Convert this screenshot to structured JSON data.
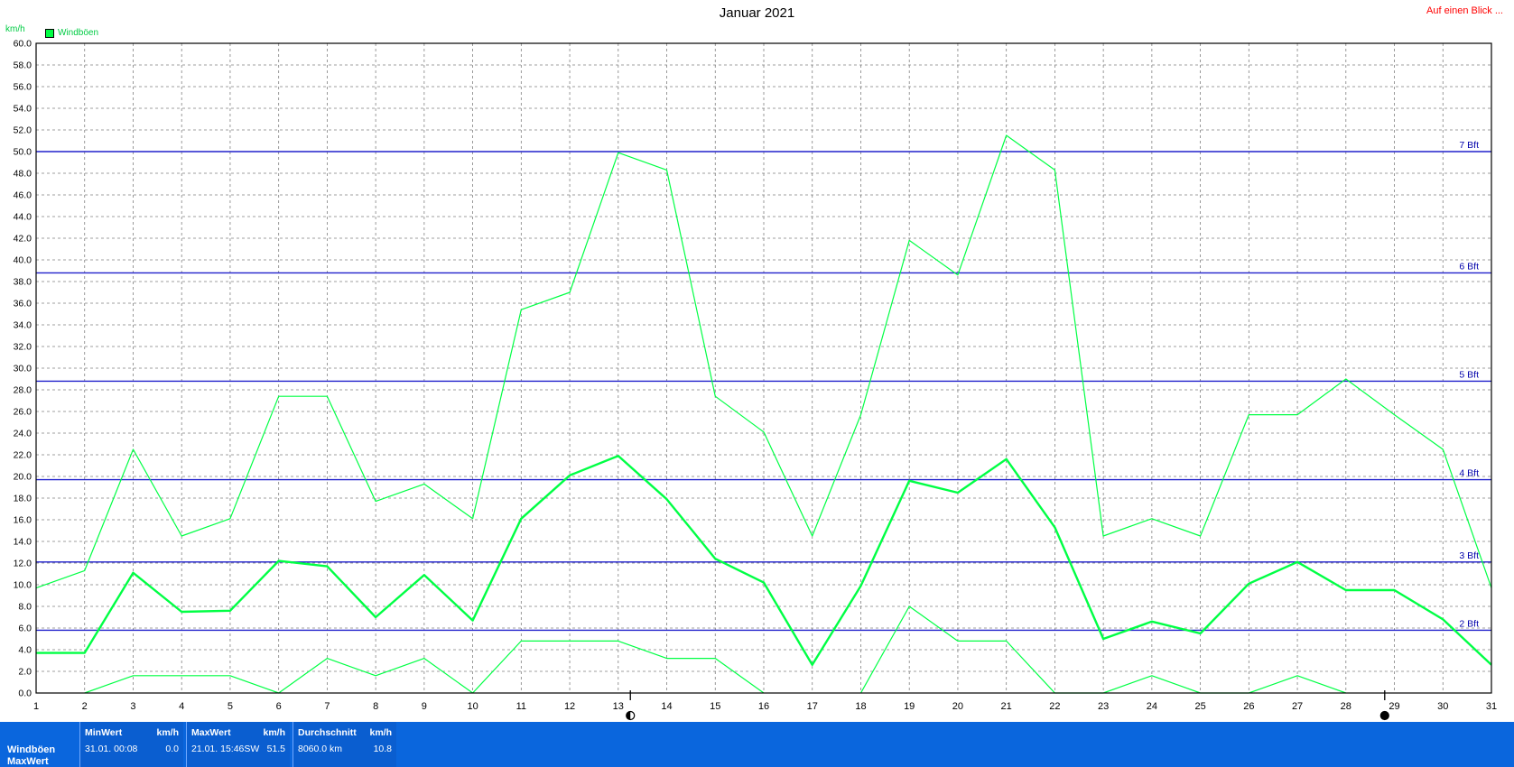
{
  "header": {
    "title": "Januar 2021",
    "link_label": "Auf einen Blick ...",
    "unit_label": "km/h"
  },
  "legend": {
    "label": "Windböen",
    "color": "#00ff44"
  },
  "chart_data": {
    "type": "line",
    "title": "Januar 2021",
    "ylabel": "km/h",
    "xlim": [
      1,
      31
    ],
    "ylim": [
      0,
      60
    ],
    "y_ticks": [
      "0.0",
      "2.0",
      "4.0",
      "6.0",
      "8.0",
      "10.0",
      "12.0",
      "14.0",
      "16.0",
      "18.0",
      "20.0",
      "22.0",
      "24.0",
      "26.0",
      "28.0",
      "30.0",
      "32.0",
      "34.0",
      "36.0",
      "38.0",
      "40.0",
      "42.0",
      "44.0",
      "46.0",
      "48.0",
      "50.0",
      "52.0",
      "54.0",
      "56.0",
      "58.0",
      "60.0"
    ],
    "x_ticks": [
      "1",
      "2",
      "3",
      "4",
      "5",
      "6",
      "7",
      "8",
      "9",
      "10",
      "11",
      "12",
      "13",
      "14",
      "15",
      "16",
      "17",
      "18",
      "19",
      "20",
      "21",
      "22",
      "23",
      "24",
      "25",
      "26",
      "27",
      "28",
      "29",
      "30",
      "31"
    ],
    "grid": true,
    "legend_position": "top-left",
    "x": [
      1,
      2,
      3,
      4,
      5,
      6,
      7,
      8,
      9,
      10,
      11,
      12,
      13,
      14,
      15,
      16,
      17,
      18,
      19,
      20,
      21,
      22,
      23,
      24,
      25,
      26,
      27,
      28,
      29,
      30,
      31
    ],
    "series": [
      {
        "name": "Windböen",
        "role": "max",
        "color": "#00ff44",
        "values": [
          9.7,
          11.3,
          22.5,
          14.5,
          16.1,
          27.4,
          27.4,
          17.7,
          19.3,
          16.1,
          35.4,
          37.0,
          49.9,
          48.3,
          27.4,
          24.1,
          14.5,
          25.7,
          41.8,
          38.6,
          51.5,
          48.3,
          14.5,
          16.1,
          14.5,
          25.7,
          25.7,
          29.0,
          25.7,
          22.5,
          9.7
        ]
      },
      {
        "role": "mean",
        "color": "#00ff44",
        "values": [
          3.7,
          3.7,
          11.1,
          7.5,
          7.6,
          12.2,
          11.7,
          7.0,
          10.9,
          6.7,
          16.1,
          20.1,
          21.9,
          17.9,
          12.4,
          10.2,
          2.6,
          9.9,
          19.6,
          18.5,
          21.6,
          15.3,
          5.0,
          6.6,
          5.5,
          10.1,
          12.1,
          9.5,
          9.5,
          6.8,
          2.6
        ]
      },
      {
        "role": "min",
        "color": "#00ff44",
        "values": [
          null,
          0.0,
          1.6,
          1.6,
          1.6,
          0.0,
          3.2,
          1.6,
          3.2,
          0.0,
          4.8,
          4.8,
          4.8,
          3.2,
          3.2,
          0.0,
          null,
          0.0,
          8.0,
          4.8,
          4.8,
          0.0,
          0.0,
          1.6,
          0.0,
          0.0,
          1.6,
          0.0,
          null,
          null,
          null
        ]
      }
    ],
    "reference_lines": [
      {
        "label": "2 Bft",
        "value": 5.8
      },
      {
        "label": "3 Bft",
        "value": 12.1
      },
      {
        "label": "4 Bft",
        "value": 19.7
      },
      {
        "label": "5 Bft",
        "value": 28.8
      },
      {
        "label": "6 Bft",
        "value": 38.8
      },
      {
        "label": "7 Bft",
        "value": 50.0
      }
    ],
    "moon_markers": [
      {
        "phase": "full-moon-icon",
        "x": 13.25
      },
      {
        "phase": "new-moon-icon",
        "x": 28.8
      }
    ]
  },
  "summary": {
    "row_labels": [
      "Windböen",
      "MaxWert"
    ],
    "min": {
      "header": "MinWert",
      "unit": "km/h",
      "left": "31.01.  00:08",
      "value": "0.0"
    },
    "max": {
      "header": "MaxWert",
      "unit": "km/h",
      "left": "21.01.  15:46SW",
      "value": "51.5"
    },
    "avg": {
      "header": "Durchschnitt",
      "unit": "km/h",
      "left": "8060.0 km",
      "value": "10.8"
    }
  }
}
